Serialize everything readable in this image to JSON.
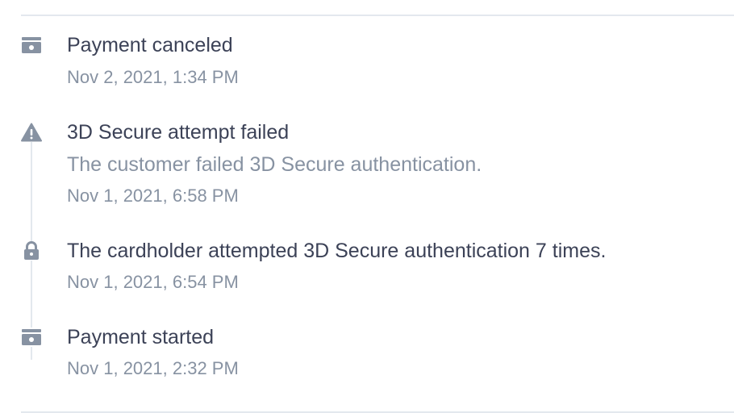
{
  "timeline": {
    "colors": {
      "icon": "#8792a2",
      "title": "#3c4257",
      "muted": "#8792a2",
      "divider": "#e3e8ee"
    },
    "events": [
      {
        "icon": "payment-icon",
        "title": "Payment canceled",
        "description": "",
        "timestamp": "Nov 2, 2021, 1:34 PM"
      },
      {
        "icon": "warning-icon",
        "title": "3D Secure attempt failed",
        "description": "The customer failed 3D Secure authentication.",
        "timestamp": "Nov 1, 2021, 6:58 PM"
      },
      {
        "icon": "lock-icon",
        "title": "The cardholder attempted 3D Secure authentication 7 times.",
        "description": "",
        "timestamp": "Nov 1, 2021, 6:54 PM"
      },
      {
        "icon": "payment-icon",
        "title": "Payment started",
        "description": "",
        "timestamp": "Nov 1, 2021, 2:32 PM"
      }
    ]
  }
}
